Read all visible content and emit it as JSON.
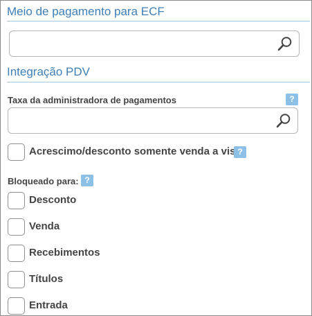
{
  "sections": {
    "ecf": {
      "title": "Meio de pagamento para ECF"
    },
    "pdv": {
      "title": "Integração PDV"
    }
  },
  "fields": {
    "meio_pagamento": {
      "value": ""
    },
    "taxa": {
      "label": "Taxa da administradora de pagamentos",
      "value": "",
      "help": "?"
    }
  },
  "acrescimo": {
    "label": "Acrescimo/desconto somente venda a vista",
    "checked": false,
    "help": "?"
  },
  "bloqueado": {
    "label": "Bloqueado para:",
    "help": "?",
    "options": [
      {
        "label": "Desconto",
        "checked": false
      },
      {
        "label": "Venda",
        "checked": false
      },
      {
        "label": "Recebimentos",
        "checked": false
      },
      {
        "label": "Títulos",
        "checked": false
      },
      {
        "label": "Entrada",
        "checked": false
      }
    ]
  },
  "icons": {
    "search": "search-icon",
    "help": "help-icon",
    "checkbox": "checkbox-unchecked"
  },
  "colors": {
    "accent": "#3f7fb5",
    "rule": "#a9c7df",
    "help_bg": "#8dc0e6",
    "border": "#b5b5b5"
  }
}
